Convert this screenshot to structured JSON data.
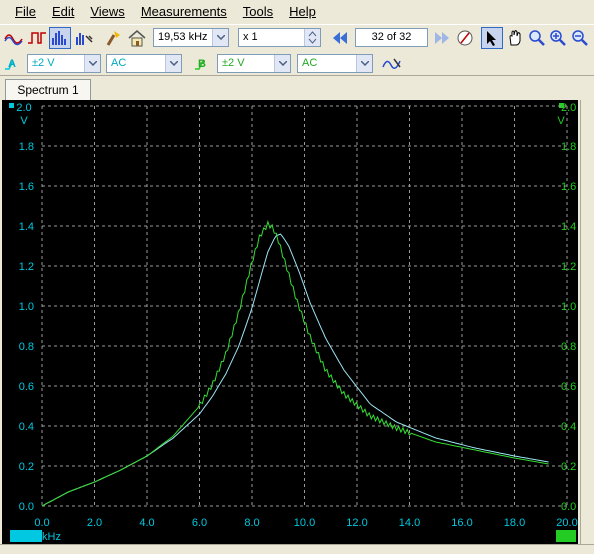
{
  "menu": [
    {
      "label": "File"
    },
    {
      "label": "Edit"
    },
    {
      "label": "Views"
    },
    {
      "label": "Measurements"
    },
    {
      "label": "Tools"
    },
    {
      "label": "Help"
    }
  ],
  "toolbar": {
    "timebase": "19,53 kHz",
    "multiplier": "x 1",
    "capture": "32 of 32"
  },
  "channel_a": {
    "letter": "A",
    "range": "±2 V",
    "coupling": "AC",
    "color": "#00c8e0"
  },
  "channel_b": {
    "letter": "B",
    "range": "±2 V",
    "coupling": "AC",
    "color": "#22cc22"
  },
  "tab_label": "Spectrum 1",
  "axis": {
    "left_unit": "V",
    "right_unit": "V",
    "x_unit": "kHz",
    "y_ticks": [
      "2.0",
      "1.8",
      "1.6",
      "1.4",
      "1.2",
      "1.0",
      "0.8",
      "0.6",
      "0.4",
      "0.2",
      "0.0"
    ],
    "x_ticks": [
      "0.0",
      "2.0",
      "4.0",
      "6.0",
      "8.0",
      "10.0",
      "12.0",
      "14.0",
      "16.0",
      "18.0",
      "20.0"
    ]
  },
  "chart_data": {
    "type": "line",
    "xlabel": "kHz",
    "ylabel": "V",
    "xlim": [
      0,
      20
    ],
    "ylim": [
      0,
      2.0
    ],
    "grid": true,
    "series": [
      {
        "name": "A",
        "color": "#9de4f2",
        "x": [
          0,
          1,
          2,
          3,
          4,
          5,
          6,
          6.5,
          7,
          7.5,
          8,
          8.3,
          8.6,
          8.9,
          9.1,
          9.4,
          9.8,
          10.2,
          10.8,
          11.5,
          12.5,
          13.5,
          15,
          16.5,
          18,
          19.3
        ],
        "y": [
          0.0,
          0.07,
          0.12,
          0.18,
          0.25,
          0.34,
          0.46,
          0.55,
          0.66,
          0.8,
          0.99,
          1.13,
          1.27,
          1.35,
          1.36,
          1.3,
          1.17,
          1.02,
          0.84,
          0.68,
          0.51,
          0.42,
          0.34,
          0.29,
          0.25,
          0.22
        ]
      },
      {
        "name": "B",
        "color": "#33dd33",
        "x": [
          0,
          1,
          2,
          3,
          4,
          5,
          6,
          6.5,
          7,
          7.5,
          8,
          8.3,
          8.6,
          8.8,
          9.0,
          9.3,
          9.7,
          10.2,
          10.8,
          11.5,
          12.5,
          13.5,
          15,
          16.5,
          18,
          19.3
        ],
        "y": [
          0.0,
          0.07,
          0.12,
          0.18,
          0.25,
          0.35,
          0.5,
          0.61,
          0.76,
          0.97,
          1.22,
          1.35,
          1.41,
          1.39,
          1.33,
          1.2,
          1.03,
          0.85,
          0.68,
          0.56,
          0.45,
          0.39,
          0.32,
          0.28,
          0.24,
          0.21
        ]
      }
    ]
  }
}
